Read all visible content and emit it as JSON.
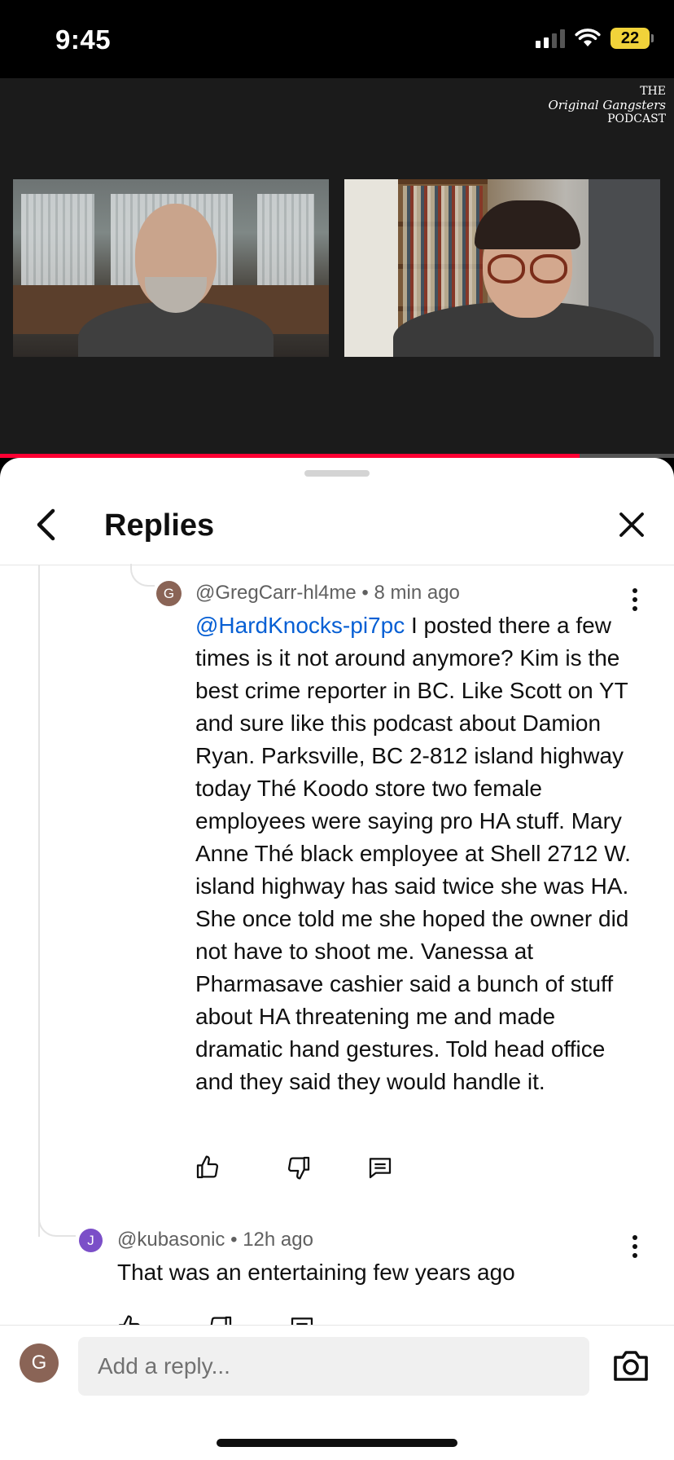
{
  "status_bar": {
    "time": "9:45",
    "battery": "22",
    "battery_color": "#f1d33a"
  },
  "video": {
    "logo_line1": "THE",
    "logo_line2": "Original Gangsters",
    "logo_line3": "PODCAST",
    "progress_fraction": 0.86,
    "progress_color": "#ff0033"
  },
  "sheet": {
    "title": "Replies"
  },
  "comments": [
    {
      "avatar_letter": "G",
      "avatar_color": "#8a6456",
      "author": "@GregCarr-hl4me",
      "time": "8 min ago",
      "mention": "@HardKnocks-pi7pc",
      "text": "I posted there a few times is it not around anymore? Kim is the best crime reporter in BC. Like Scott on YT and sure like this podcast about Damion Ryan. Parksville, BC 2-812 island highway today Thé Koodo store two female employees were saying pro HA stuff. Mary Anne Thé black employee at Shell 2712 W. island highway has said twice she was HA. She once told me she hoped the owner did not have to shoot me. Vanessa at Pharmasave cashier said a bunch of stuff about HA threatening me and made dramatic hand gestures. Told head office and they said they would handle it."
    },
    {
      "avatar_letter": "J",
      "avatar_color": "#7b4fc8",
      "author": "@kubasonic",
      "time": "12h ago",
      "text": "That was an entertaining few years ago"
    }
  ],
  "reply_bar": {
    "avatar_letter": "G",
    "avatar_color": "#8a6456",
    "placeholder": "Add a reply..."
  },
  "icons": [
    "back-arrow-icon",
    "close-icon",
    "more-vert-icon",
    "like-icon",
    "dislike-icon",
    "reply-icon",
    "camera-icon",
    "wifi-icon",
    "signal-icon"
  ]
}
